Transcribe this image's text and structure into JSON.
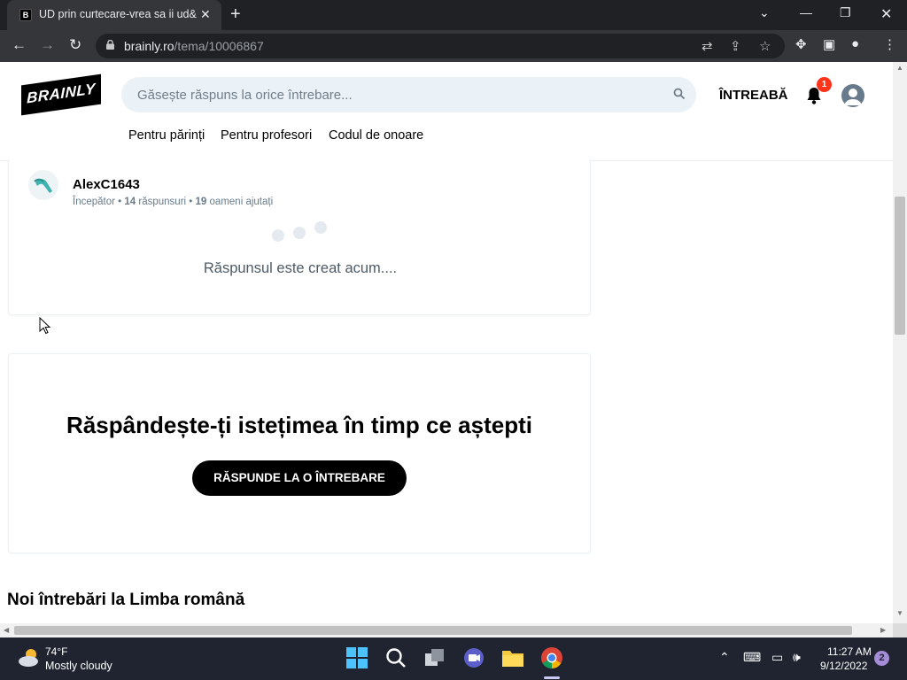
{
  "browser": {
    "tab_title": "UD prin curtecare-vrea sa ii ud&",
    "tab_favicon": "B",
    "url_host": "brainly.ro",
    "url_path": "/tema/10006867"
  },
  "header": {
    "logo": "BRAINLY",
    "search_placeholder": "Găsește răspuns la orice întrebare...",
    "ask_label": "ÎNTREABĂ",
    "notification_count": "1",
    "subnav": [
      "Pentru părinți",
      "Pentru profesori",
      "Codul de onoare"
    ]
  },
  "answer": {
    "user_name": "AlexC1643",
    "rank": "Începător",
    "answers_count": "14",
    "answers_label": "răspunsuri",
    "helped_count": "19",
    "helped_label": "oameni ajutați",
    "status": "Răspunsul este creat acum...."
  },
  "promo": {
    "title": "Răspândește-ți istețimea în timp ce aștepti",
    "button_label": "RĂSPUNDE LA O ÎNTREBARE"
  },
  "section": {
    "new_questions_title": "Noi întrebări la Limba română"
  },
  "taskbar": {
    "temperature": "74°F",
    "weather": "Mostly cloudy",
    "time": "11:27 AM",
    "date": "9/12/2022",
    "notifications": "2"
  },
  "colors": {
    "brand": "#000000",
    "search_bg": "#ebf2f7",
    "badge": "#ff341a",
    "muted_text": "#687b8c"
  }
}
